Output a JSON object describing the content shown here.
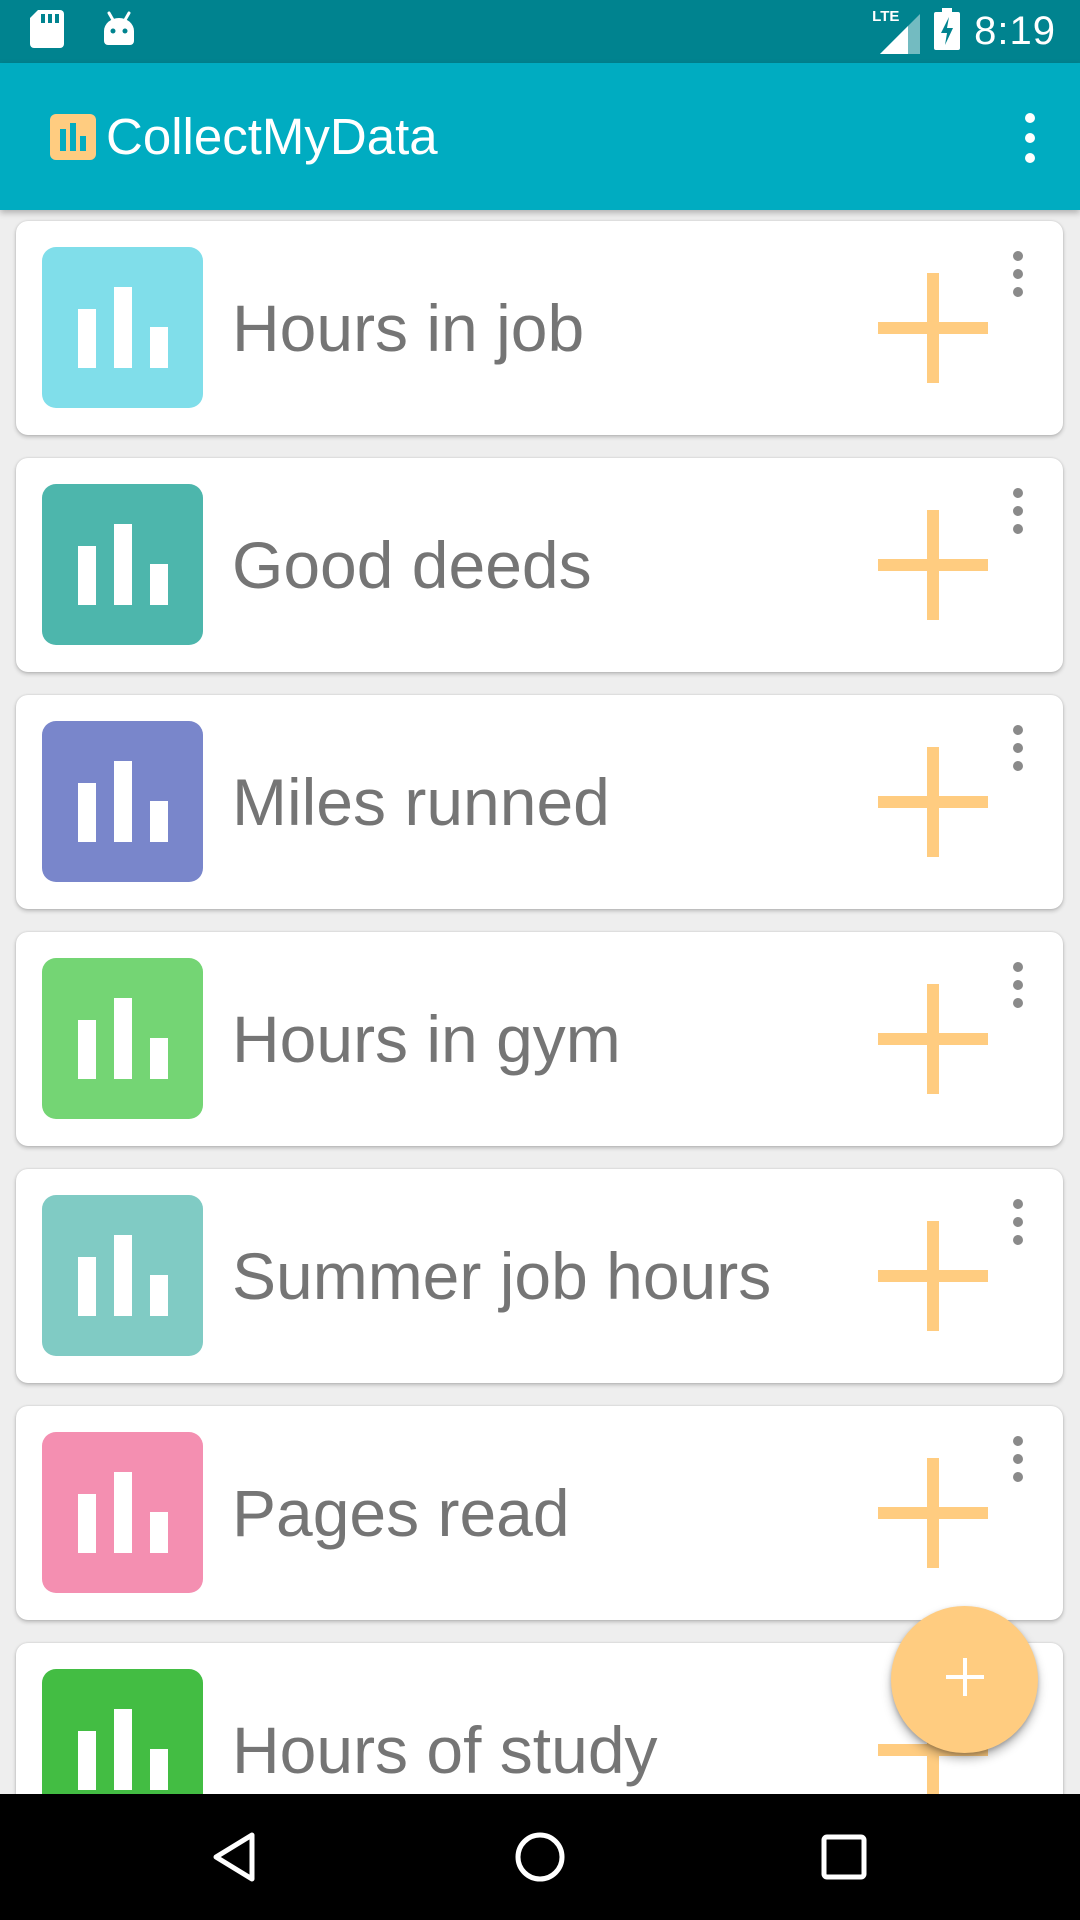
{
  "status_bar": {
    "time": "8:19",
    "network_label": "LTE",
    "left_icons": [
      "sd-card-icon",
      "android-icon"
    ],
    "right_icons": [
      "signal-icon",
      "battery-charging-icon"
    ]
  },
  "app_bar": {
    "title": "CollectMyData",
    "logo_icon": "bar-chart-icon",
    "menu_icon": "more-vert-icon"
  },
  "accent_color": "#ffcc80",
  "items": [
    {
      "title": "Hours in job",
      "color": "#80deea"
    },
    {
      "title": "Good deeds",
      "color": "#4db6ac"
    },
    {
      "title": "Miles runned",
      "color": "#7986cb"
    },
    {
      "title": "Hours in gym",
      "color": "#74d574"
    },
    {
      "title": "Summer job hours",
      "color": "#80cbc4"
    },
    {
      "title": "Pages read",
      "color": "#f48fb1"
    },
    {
      "title": "Hours of study",
      "color": "#43bd43"
    }
  ],
  "fab": {
    "icon": "plus-icon"
  },
  "nav_bar": {
    "buttons": [
      "back-icon",
      "home-icon",
      "recents-icon"
    ]
  }
}
